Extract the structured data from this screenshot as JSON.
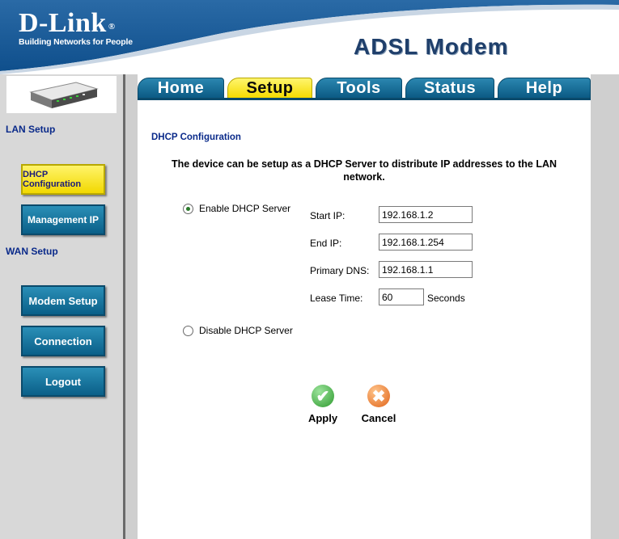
{
  "header": {
    "brand": "D-Link",
    "brand_mark": "®",
    "tagline": "Building Networks for People",
    "product": "ADSL Modem"
  },
  "sidebar": {
    "device_image": "modem-device-image",
    "lan_heading": "LAN Setup",
    "lan_items": [
      "DHCP Configuration",
      "Management IP"
    ],
    "wan_heading": "WAN Setup",
    "wan_items": [
      "Modem Setup",
      "Connection",
      "Logout"
    ]
  },
  "tabs": [
    "Home",
    "Setup",
    "Tools",
    "Status",
    "Help"
  ],
  "active_tab": "Setup",
  "content": {
    "title": "DHCP Configuration",
    "description": "The device can be setup as a DHCP Server to distribute IP addresses to the LAN network.",
    "enable_label": "Enable DHCP Server",
    "disable_label": "Disable DHCP Server",
    "dhcp_enabled": true,
    "fields": {
      "start_ip": {
        "label": "Start IP:",
        "value": "192.168.1.2"
      },
      "end_ip": {
        "label": "End IP:",
        "value": "192.168.1.254"
      },
      "primary_dns": {
        "label": "Primary DNS:",
        "value": "192.168.1.1"
      },
      "lease_time": {
        "label": "Lease Time:",
        "value": "60",
        "unit": "Seconds"
      }
    },
    "apply_label": "Apply",
    "cancel_label": "Cancel"
  },
  "colors": {
    "header_blue": "#1d5f9a",
    "tab_blue": "#0b5a84",
    "tab_active_yellow": "#f4db00",
    "heading_blue": "#0a2a8a",
    "apply_green": "#3aa23a",
    "cancel_orange": "#e8741a"
  }
}
